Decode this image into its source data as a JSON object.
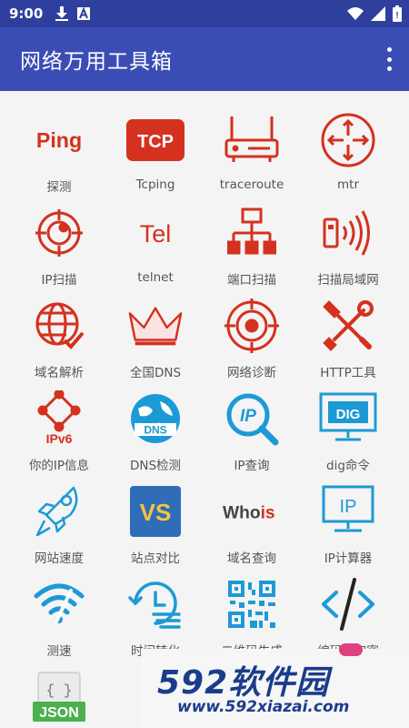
{
  "status_bar": {
    "time": "9:00",
    "icons_left": [
      "download-icon",
      "a-badge-icon"
    ],
    "icons_right": [
      "wifi-icon",
      "signal-icon",
      "battery-icon"
    ]
  },
  "app_bar": {
    "title": "网络万用工具箱",
    "menu_icon": "more-vert-icon",
    "color": "#3b4db5",
    "status_color": "#2f3f9e"
  },
  "tools": [
    {
      "label": "探测",
      "icon": "ping-icon",
      "icon_text": "Ping"
    },
    {
      "label": "Tcping",
      "icon": "tcp-icon",
      "icon_text": "TCP"
    },
    {
      "label": "traceroute",
      "icon": "router-icon"
    },
    {
      "label": "mtr",
      "icon": "mtr-router-icon"
    },
    {
      "label": "IP扫描",
      "icon": "ip-radar-icon"
    },
    {
      "label": "telnet",
      "icon": "tel-icon",
      "icon_text": "Tel"
    },
    {
      "label": "端口扫描",
      "icon": "network-tree-icon"
    },
    {
      "label": "扫描局域网",
      "icon": "wireless-scan-icon"
    },
    {
      "label": "域名解析",
      "icon": "globe-check-icon"
    },
    {
      "label": "全国DNS",
      "icon": "crown-icon"
    },
    {
      "label": "网络诊断",
      "icon": "target-icon"
    },
    {
      "label": "HTTP工具",
      "icon": "tools-icon"
    },
    {
      "label": "你的IP信息",
      "icon": "ipv6-icon",
      "icon_text": "IPv6"
    },
    {
      "label": "DNS检测",
      "icon": "dns-globe-icon",
      "icon_text": "DNS"
    },
    {
      "label": "IP查询",
      "icon": "ip-search-icon",
      "icon_text": "IP"
    },
    {
      "label": "dig命令",
      "icon": "dig-monitor-icon",
      "icon_text": "DIG"
    },
    {
      "label": "网站速度",
      "icon": "rocket-icon"
    },
    {
      "label": "站点对比",
      "icon": "vs-icon",
      "icon_text": "VS"
    },
    {
      "label": "域名查询",
      "icon": "whois-icon",
      "icon_text_a": "Who",
      "icon_text_b": "is"
    },
    {
      "label": "IP计算器",
      "icon": "ip-monitor-icon",
      "icon_text": "IP"
    },
    {
      "label": "测速",
      "icon": "wifi-speed-icon"
    },
    {
      "label": "时间转化",
      "icon": "clock-history-icon"
    },
    {
      "label": "二维码生成",
      "icon": "qr-code-icon"
    },
    {
      "label": "编码与加密",
      "icon": "code-icon"
    },
    {
      "label": "",
      "icon": "json-icon",
      "icon_text": "JSON",
      "icon_text_b": "{ }"
    }
  ],
  "watermark": {
    "main_num": "592",
    "main_cn": "软件园",
    "sub": "www.592xiazai.com"
  },
  "colors": {
    "red": "#d4311f",
    "blue": "#1c9ad6",
    "navy": "#1b3c8c"
  }
}
